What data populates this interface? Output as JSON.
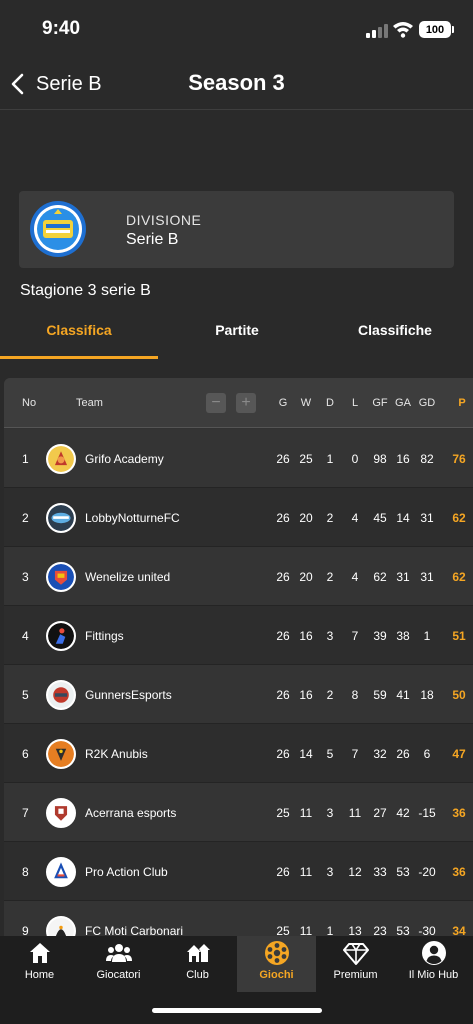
{
  "status": {
    "time": "9:40",
    "battery": "100"
  },
  "header": {
    "back_label": "Serie B",
    "title": "Season 3"
  },
  "division": {
    "label": "DIVISIONE",
    "value": "Serie B",
    "logo_icon": "serie-b-logo"
  },
  "subtitle": "Stagione 3 serie B",
  "tabs": [
    {
      "label": "Classifica",
      "active": true
    },
    {
      "label": "Partite",
      "active": false
    },
    {
      "label": "Classifiche",
      "active": false
    }
  ],
  "table": {
    "headers": {
      "no": "No",
      "team": "Team",
      "g": "G",
      "w": "W",
      "d": "D",
      "l": "L",
      "gf": "GF",
      "ga": "GA",
      "gd": "GD",
      "p": "P"
    },
    "controls": {
      "minus": "−",
      "plus": "+"
    },
    "rows": [
      {
        "no": "1",
        "team": "Grifo Academy",
        "g": "26",
        "w": "25",
        "d": "1",
        "l": "0",
        "gf": "98",
        "ga": "16",
        "gd": "82",
        "p": "76"
      },
      {
        "no": "2",
        "team": "LobbyNotturneFC",
        "g": "26",
        "w": "20",
        "d": "2",
        "l": "4",
        "gf": "45",
        "ga": "14",
        "gd": "31",
        "p": "62"
      },
      {
        "no": "3",
        "team": "Wenelize united",
        "g": "26",
        "w": "20",
        "d": "2",
        "l": "4",
        "gf": "62",
        "ga": "31",
        "gd": "31",
        "p": "62"
      },
      {
        "no": "4",
        "team": "Fittings",
        "g": "26",
        "w": "16",
        "d": "3",
        "l": "7",
        "gf": "39",
        "ga": "38",
        "gd": "1",
        "p": "51"
      },
      {
        "no": "5",
        "team": "GunnersEsports",
        "g": "26",
        "w": "16",
        "d": "2",
        "l": "8",
        "gf": "59",
        "ga": "41",
        "gd": "18",
        "p": "50"
      },
      {
        "no": "6",
        "team": "R2K Anubis",
        "g": "26",
        "w": "14",
        "d": "5",
        "l": "7",
        "gf": "32",
        "ga": "26",
        "gd": "6",
        "p": "47"
      },
      {
        "no": "7",
        "team": "Acerrana esports",
        "g": "25",
        "w": "11",
        "d": "3",
        "l": "11",
        "gf": "27",
        "ga": "42",
        "gd": "-15",
        "p": "36"
      },
      {
        "no": "8",
        "team": "Pro Action Club",
        "g": "26",
        "w": "11",
        "d": "3",
        "l": "12",
        "gf": "33",
        "ga": "53",
        "gd": "-20",
        "p": "36"
      },
      {
        "no": "9",
        "team": "FC Moti Carbonari",
        "g": "25",
        "w": "11",
        "d": "1",
        "l": "13",
        "gf": "23",
        "ga": "53",
        "gd": "-30",
        "p": "34"
      }
    ]
  },
  "bottom_nav": [
    {
      "label": "Home",
      "icon": "home-icon",
      "active": false
    },
    {
      "label": "Giocatori",
      "icon": "players-icon",
      "active": false
    },
    {
      "label": "Club",
      "icon": "club-icon",
      "active": false
    },
    {
      "label": "Giochi",
      "icon": "ball-icon",
      "active": true
    },
    {
      "label": "Premium",
      "icon": "diamond-icon",
      "active": false
    },
    {
      "label": "Il Mio Hub",
      "icon": "profile-icon",
      "active": false
    }
  ],
  "colors": {
    "accent": "#f5a623",
    "background": "#2a2a2a",
    "card": "#3b3b3b"
  }
}
